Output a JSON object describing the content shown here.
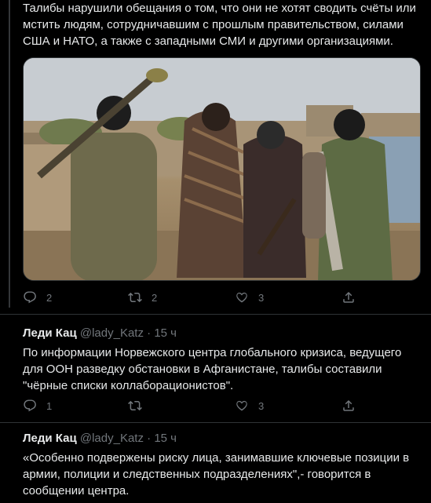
{
  "tweets": [
    {
      "text": "Талибы нарушили обещания о том, что они не хотят сводить счёты или мстить людям, сотрудничавшим с прошлым правительством, силами США и НАТО, а также с западными СМИ и другими организациями.",
      "reply_count": "2",
      "retweet_count": "2",
      "like_count": "3"
    },
    {
      "name": "Леди Кац",
      "handle": "@lady_Katz",
      "dot": "·",
      "time": "15 ч",
      "text": "По информации Норвежского центра глобального кризиса, ведущего для ООН разведку обстановки в Афганистане, талибы составили \"чёрные списки коллаборационистов\".",
      "reply_count": "1",
      "retweet_count": "",
      "like_count": "3"
    },
    {
      "name": "Леди Кац",
      "handle": "@lady_Katz",
      "dot": "·",
      "time": "15 ч",
      "text": "«Особенно подвержены риску лица, занимавшие ключевые позиции в армии, полиции и следственных подразделениях\",- говорится в сообщении центра."
    }
  ],
  "icons": {
    "reply": "reply-icon",
    "retweet": "retweet-icon",
    "like": "like-icon",
    "share": "share-icon"
  },
  "colors": {
    "background": "#000000",
    "text": "#e7e9ea",
    "muted": "#71767b",
    "divider": "#2f3336"
  }
}
